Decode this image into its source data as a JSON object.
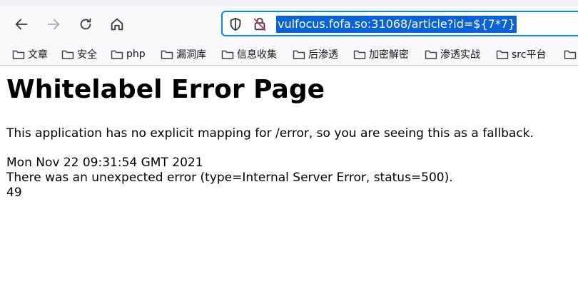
{
  "browser": {
    "url": "vulfocus.fofa.so:31068/article?id=${7*7}",
    "nav_icons": [
      "back-arrow-icon",
      "forward-arrow-icon",
      "reload-icon",
      "home-icon"
    ]
  },
  "bookmarks": [
    {
      "label": "文章"
    },
    {
      "label": "安全"
    },
    {
      "label": "php"
    },
    {
      "label": "漏洞库"
    },
    {
      "label": "信息收集"
    },
    {
      "label": "后渗透"
    },
    {
      "label": "加密解密"
    },
    {
      "label": "渗透实战"
    },
    {
      "label": "src平台"
    }
  ],
  "page": {
    "title": "Whitelabel Error Page",
    "message": "This application has no explicit mapping for /error, so you are seeing this as a fallback.",
    "timestamp": "Mon Nov 22 09:31:54 GMT 2021",
    "error_line": "There was an unexpected error (type=Internal Server Error, status=500).",
    "result": "49"
  },
  "colors": {
    "accent": "#0a84ff",
    "selection": "#0a63d6"
  }
}
